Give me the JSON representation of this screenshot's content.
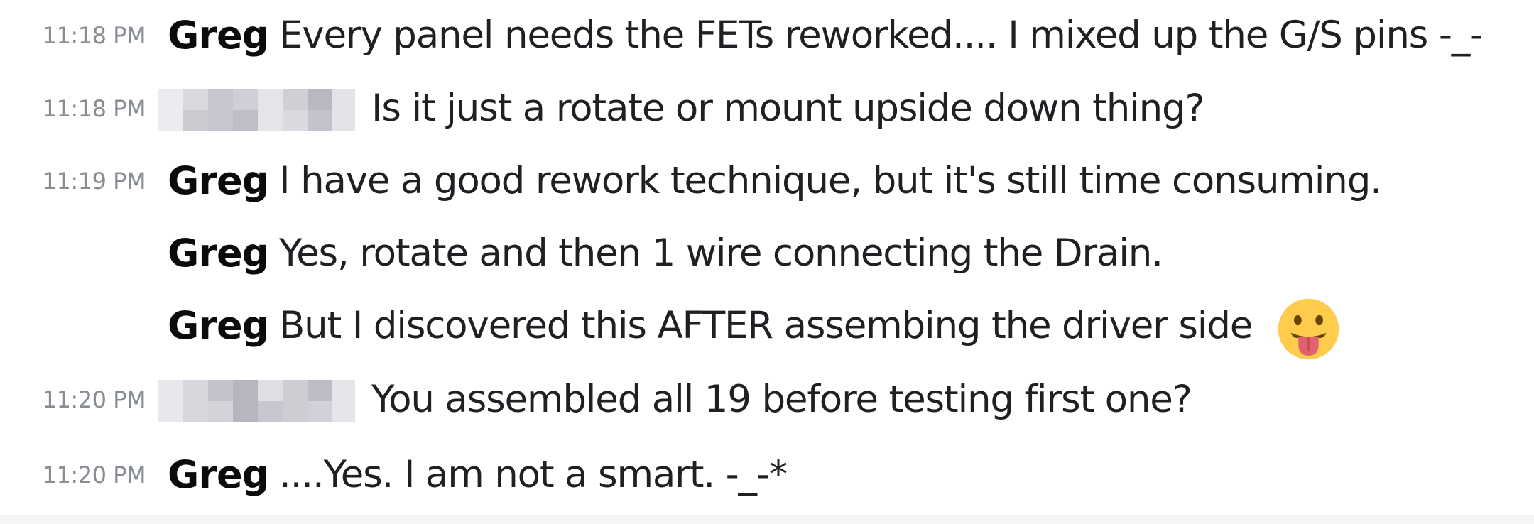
{
  "messages": [
    {
      "time": "11:18 PM",
      "user": "Greg",
      "text": "Every panel needs the FETs reworked.... I mixed up the G/S pins -_-"
    },
    {
      "time": "11:18 PM",
      "user": "",
      "user_redacted": true,
      "text": "Is it just a rotate or mount upside down thing?"
    },
    {
      "time": "11:19 PM",
      "user": "Greg",
      "text": "I have a good rework technique, but it's still time consuming."
    },
    {
      "time": "",
      "user": "Greg",
      "text": "Yes, rotate and then 1 wire connecting the Drain."
    },
    {
      "time": "",
      "user": "Greg",
      "text": "But I discovered this AFTER assembing the driver side",
      "emoji": "stuck-out-tongue"
    },
    {
      "time": "11:20 PM",
      "user": "",
      "user_redacted": true,
      "text": "You assembled all 19 before testing first one?"
    },
    {
      "time": "11:20 PM",
      "user": "Greg",
      "text": "....Yes. I am not a smart. -_-*"
    }
  ],
  "colors": {
    "timestamp": "#888d94",
    "username": "#0b0b0d",
    "message_text": "#1f2023",
    "background": "#ffffff",
    "bottom_strip": "#f5f5f6",
    "emoji_face": "#ffcc4d",
    "emoji_tongue": "#e0616f"
  }
}
